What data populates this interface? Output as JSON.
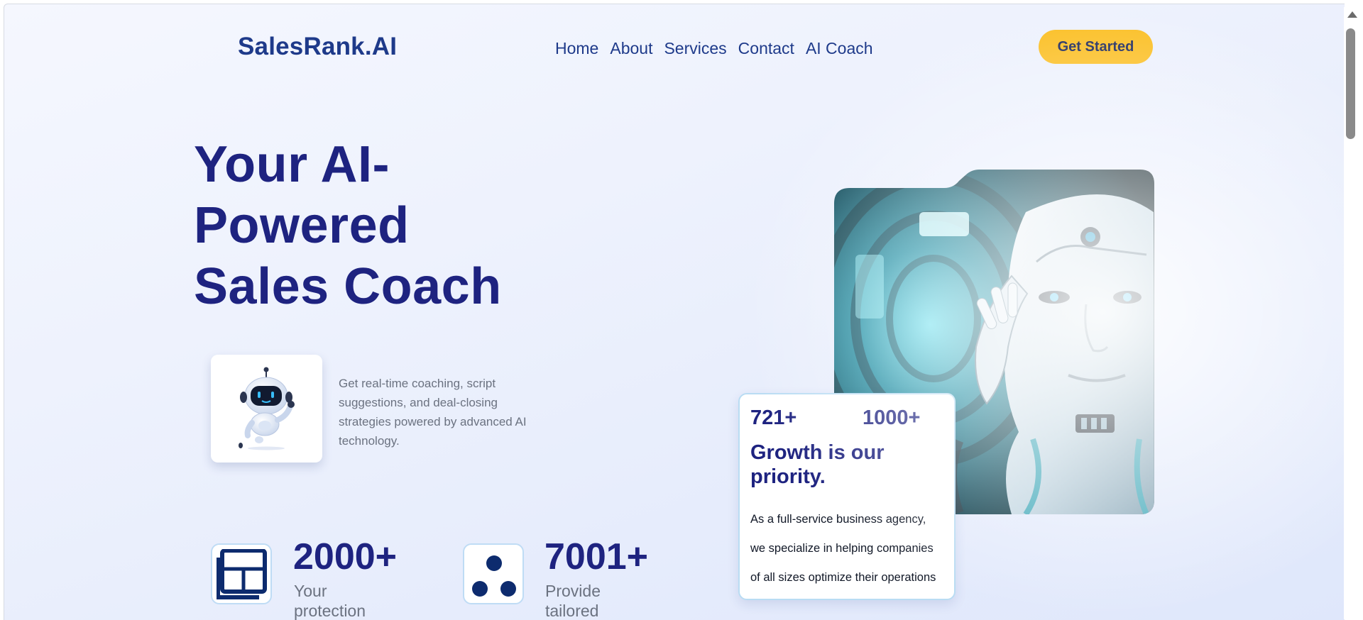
{
  "header": {
    "logo": "SalesRank.AI",
    "nav": [
      "Home",
      "About",
      "Services",
      "Contact",
      "AI Coach"
    ],
    "cta_label": "Get Started"
  },
  "hero": {
    "title_lines": [
      "Your AI-",
      "Powered",
      "Sales Coach"
    ],
    "description": "Get real-time coaching, script suggestions, and deal-closing strategies powered by advanced AI technology."
  },
  "stats": [
    {
      "value": "2000+",
      "label_lines": [
        "Your",
        "protection"
      ],
      "icon": "dashboard-layout-icon"
    },
    {
      "value": "7001+",
      "label_lines": [
        "Provide",
        "tailored"
      ],
      "icon": "three-dots-icon"
    }
  ],
  "card": {
    "num1": "721+",
    "num2": "1000+",
    "title_lines": [
      "Growth is our",
      "priority."
    ],
    "text_lines": [
      "As a full-service business agency,",
      "we specialize in helping companies",
      "of all sizes optimize their operations"
    ]
  },
  "colors": {
    "brand_navy": "#1e2380",
    "accent_yellow": "#fbbf24",
    "muted_text": "#6b7280",
    "card_border": "#b9dcf3"
  },
  "icons": [
    "robot-mascot-icon",
    "dashboard-layout-icon",
    "three-dots-icon",
    "scroll-up-arrow-icon"
  ]
}
